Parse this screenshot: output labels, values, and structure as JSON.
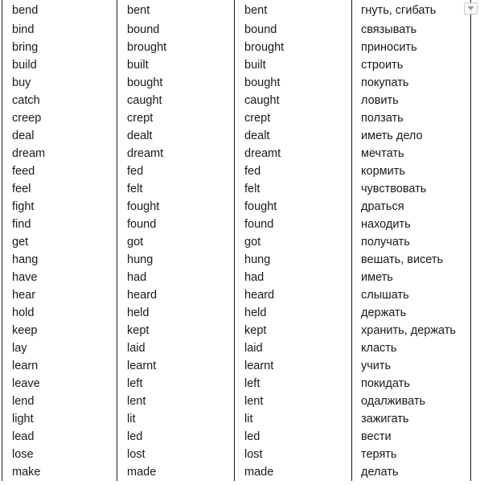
{
  "panel": {
    "name": "irregular-verbs-table",
    "background_color": "#ffffff",
    "text_color": "#1a1a1a",
    "border_color": "#1a1a1a"
  },
  "scroll_control": {
    "icon": "chevron-down-icon",
    "label": "",
    "border_color": "#c8c8c8",
    "background_color": "#fbfbfb"
  },
  "table": {
    "columns": [
      {
        "key": "base",
        "header": ""
      },
      {
        "key": "past",
        "header": ""
      },
      {
        "key": "participle",
        "header": ""
      },
      {
        "key": "translation",
        "header": ""
      }
    ],
    "rows": [
      {
        "base": "bend",
        "past": "bent",
        "participle": "bent",
        "translation": "гнуть, сгибать"
      },
      {
        "base": "bind",
        "past": "bound",
        "participle": "bound",
        "translation": "связывать"
      },
      {
        "base": "bring",
        "past": "brought",
        "participle": "brought",
        "translation": "приносить"
      },
      {
        "base": "build",
        "past": "built",
        "participle": "built",
        "translation": "строить"
      },
      {
        "base": "buy",
        "past": "bought",
        "participle": "bought",
        "translation": "покупать"
      },
      {
        "base": "catch",
        "past": "caught",
        "participle": "caught",
        "translation": "ловить"
      },
      {
        "base": "creep",
        "past": "crept",
        "participle": "crept",
        "translation": "ползать"
      },
      {
        "base": "deal",
        "past": "dealt",
        "participle": "dealt",
        "translation": "иметь дело"
      },
      {
        "base": "dream",
        "past": "dreamt",
        "participle": "dreamt",
        "translation": "мечтать"
      },
      {
        "base": "feed",
        "past": "fed",
        "participle": "fed",
        "translation": "кормить"
      },
      {
        "base": "feel",
        "past": "felt",
        "participle": "felt",
        "translation": "чувствовать"
      },
      {
        "base": "fight",
        "past": "fought",
        "participle": "fought",
        "translation": "драться"
      },
      {
        "base": "find",
        "past": "found",
        "participle": "found",
        "translation": "находить"
      },
      {
        "base": "get",
        "past": "got",
        "participle": "got",
        "translation": "получать"
      },
      {
        "base": "hang",
        "past": "hung",
        "participle": "hung",
        "translation": "вешать, висеть"
      },
      {
        "base": "have",
        "past": "had",
        "participle": "had",
        "translation": "иметь"
      },
      {
        "base": "hear",
        "past": "heard",
        "participle": "heard",
        "translation": "слышать"
      },
      {
        "base": "hold",
        "past": "held",
        "participle": "held",
        "translation": "держать"
      },
      {
        "base": "keep",
        "past": "kept",
        "participle": "kept",
        "translation": "хранить, держать"
      },
      {
        "base": "lay",
        "past": "laid",
        "participle": "laid",
        "translation": "класть"
      },
      {
        "base": "learn",
        "past": "learnt",
        "participle": "learnt",
        "translation": "учить"
      },
      {
        "base": "leave",
        "past": "left",
        "participle": "left",
        "translation": "покидать"
      },
      {
        "base": "lend",
        "past": "lent",
        "participle": "lent",
        "translation": "одалживать"
      },
      {
        "base": "light",
        "past": "lit",
        "participle": "lit",
        "translation": "зажигать"
      },
      {
        "base": "lead",
        "past": "led",
        "participle": "led",
        "translation": "вести"
      },
      {
        "base": "lose",
        "past": "lost",
        "participle": "lost",
        "translation": "терять"
      },
      {
        "base": "make",
        "past": "made",
        "participle": "made",
        "translation": "делать"
      }
    ]
  }
}
